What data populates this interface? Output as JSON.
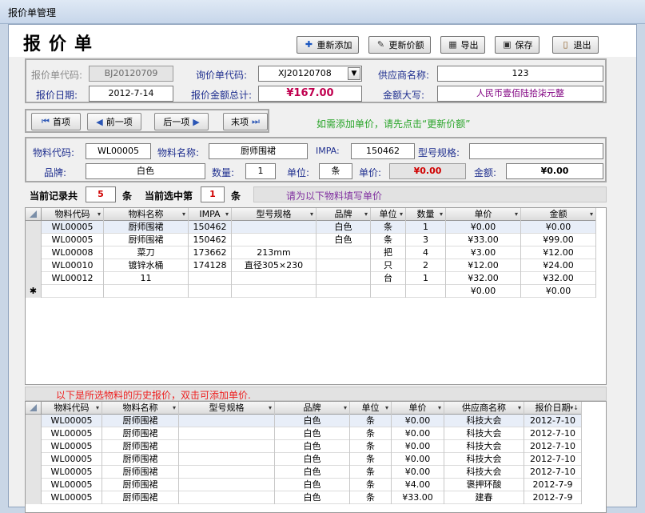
{
  "window": {
    "title": "报价单管理"
  },
  "page_title": "报价单",
  "toolbar": {
    "add_label": "重新添加",
    "update_price_label": "更新价额",
    "export_label": "导出",
    "save_label": "保存",
    "exit_label": "退出"
  },
  "header": {
    "quote_code_label": "报价单代码:",
    "quote_code": "BJ20120709",
    "inquiry_code_label": "询价单代码:",
    "inquiry_code": "XJ20120708",
    "supplier_label": "供应商名称:",
    "supplier": "123",
    "quote_date_label": "报价日期:",
    "quote_date": "2012-7-14",
    "total_label": "报价金额总计:",
    "total": "¥167.00",
    "amount_caps_label": "金额大写:",
    "amount_caps": "人民币壹佰陆拾柒元整"
  },
  "nav": {
    "first": "首项",
    "prev": "前一项",
    "next": "后一项",
    "last": "末项",
    "hint": "如需添加单价，请先点击“更新价额”"
  },
  "detail": {
    "code_label": "物料代码:",
    "code": "WL00005",
    "name_label": "物料名称:",
    "name": "厨师围裙",
    "impa_label": "IMPA:",
    "impa": "150462",
    "spec_label": "型号规格:",
    "spec": "",
    "brand_label": "品牌:",
    "brand": "白色",
    "qty_label": "数量:",
    "qty": "1",
    "unit_label": "单位:",
    "unit": "条",
    "price_label": "单价:",
    "price": "¥0.00",
    "amount_label": "金额:",
    "amount": "¥0.00"
  },
  "record_bar": {
    "total_prefix": "当前记录共",
    "total_count": "5",
    "unit1": "条",
    "current_prefix": "当前选中第",
    "current_index": "1",
    "unit2": "条",
    "hint": "请为以下物料填写单价"
  },
  "items_table": {
    "columns": [
      "物料代码",
      "物料名称",
      "IMPA",
      "型号规格",
      "品牌",
      "单位",
      "数量",
      "单价",
      "金额"
    ],
    "rows": [
      [
        "WL00005",
        "厨师围裙",
        "150462",
        "",
        "白色",
        "条",
        "1",
        "¥0.00",
        "¥0.00"
      ],
      [
        "WL00005",
        "厨师围裙",
        "150462",
        "",
        "白色",
        "条",
        "3",
        "¥33.00",
        "¥99.00"
      ],
      [
        "WL00008",
        "菜刀",
        "173662",
        "213mm",
        "",
        "把",
        "4",
        "¥3.00",
        "¥12.00"
      ],
      [
        "WL00010",
        "镀锌水桶",
        "174128",
        "直径305×230",
        "",
        "只",
        "2",
        "¥12.00",
        "¥24.00"
      ],
      [
        "WL00012",
        "11",
        "",
        "",
        "",
        "台",
        "1",
        "¥32.00",
        "¥32.00"
      ]
    ],
    "new_row": {
      "marker": "✱",
      "price": "¥0.00",
      "amount": "¥0.00"
    }
  },
  "history": {
    "hint": "以下是所选物料的历史报价，双击可添加单价.",
    "columns": [
      "物料代码",
      "物料名称",
      "型号规格",
      "品牌",
      "单位",
      "单价",
      "供应商名称",
      "报价日期"
    ],
    "rows": [
      [
        "WL00005",
        "厨师围裙",
        "",
        "白色",
        "条",
        "¥0.00",
        "科技大会",
        "2012-7-10"
      ],
      [
        "WL00005",
        "厨师围裙",
        "",
        "白色",
        "条",
        "¥0.00",
        "科技大会",
        "2012-7-10"
      ],
      [
        "WL00005",
        "厨师围裙",
        "",
        "白色",
        "条",
        "¥0.00",
        "科技大会",
        "2012-7-10"
      ],
      [
        "WL00005",
        "厨师围裙",
        "",
        "白色",
        "条",
        "¥0.00",
        "科技大会",
        "2012-7-10"
      ],
      [
        "WL00005",
        "厨师围裙",
        "",
        "白色",
        "条",
        "¥0.00",
        "科技大会",
        "2012-7-10"
      ],
      [
        "WL00005",
        "厨师围裙",
        "",
        "白色",
        "条",
        "¥4.00",
        "褒押环酸",
        "2012-7-9"
      ],
      [
        "WL00005",
        "厨师围裙",
        "",
        "白色",
        "条",
        "¥33.00",
        "建春",
        "2012-7-9"
      ]
    ]
  }
}
